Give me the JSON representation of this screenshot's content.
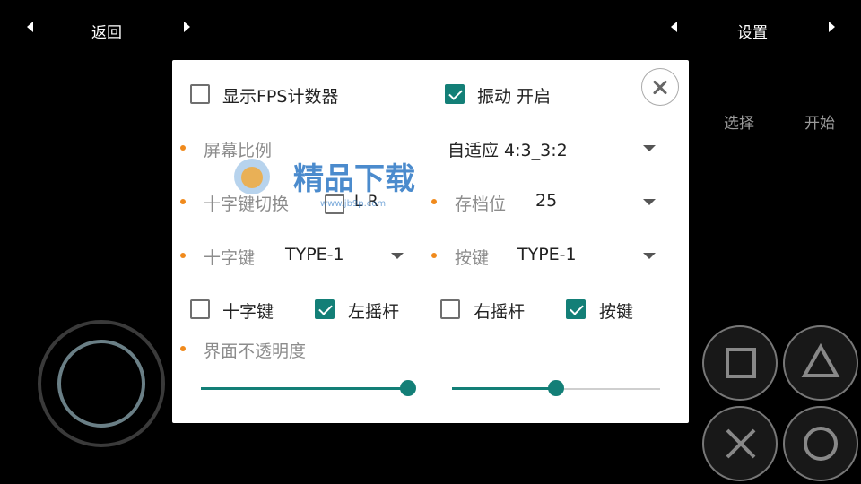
{
  "topbar": {
    "left_label": "返回",
    "right_label": "设置"
  },
  "side": {
    "select_label": "选择",
    "start_label": "开始"
  },
  "dialog": {
    "show_fps": {
      "label": "显示FPS计数器",
      "checked": false
    },
    "vibration": {
      "label": "振动 开启",
      "checked": true
    },
    "aspect": {
      "label": "屏幕比例",
      "value": "自适应 4:3_3:2"
    },
    "dpad_switch": {
      "label": "十字键切换",
      "value": "L R",
      "checked": false
    },
    "save_slot": {
      "label": "存档位",
      "value": "25"
    },
    "dpad_type": {
      "label": "十字键",
      "value": "TYPE-1"
    },
    "button_type": {
      "label": "按键",
      "value": "TYPE-1"
    },
    "visibility": [
      {
        "label": "十字键",
        "checked": false
      },
      {
        "label": "左摇杆",
        "checked": true
      },
      {
        "label": "右摇杆",
        "checked": false
      },
      {
        "label": "按键",
        "checked": true
      }
    ],
    "opacity": {
      "label": "界面不透明度",
      "slider1": 1.0,
      "slider2": 0.5
    }
  },
  "watermark": {
    "text": "精品下载",
    "url": "www.jb9p.com"
  },
  "colors": {
    "accent": "#137f77",
    "bullet": "#f08a1c"
  }
}
